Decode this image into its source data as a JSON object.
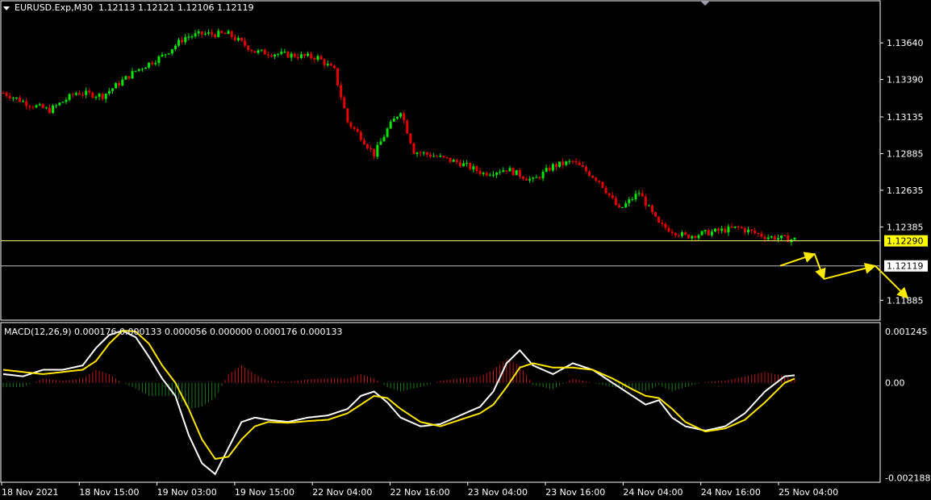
{
  "window": {
    "symbol_header": "EURUSD.Exp,M30",
    "ohlc": [
      "1.12113",
      "1.12121",
      "1.12106",
      "1.12119"
    ]
  },
  "colors": {
    "background": "#000000",
    "frame": "#ffffff",
    "bull": "#00e600",
    "bear": "#e60000",
    "level_line": "#ffff66",
    "price_line": "#c0c0c0",
    "arrow": "#ffeb00",
    "macd_main": "#ffffff",
    "macd_signal": "#ffe600",
    "hist_pos": "#c01818",
    "hist_neg": "#187818"
  },
  "chart_data": [
    {
      "type": "candlestick",
      "title": "EURUSD.Exp,M30",
      "ylim": [
        1.1176,
        1.1385
      ],
      "y_ticks": [
        "1.13640",
        "1.13390",
        "1.13135",
        "1.12885",
        "1.12635",
        "1.12385",
        "1.11885"
      ],
      "y_tick_values": [
        1.1364,
        1.1339,
        1.13135,
        1.12885,
        1.12635,
        1.12385,
        1.11885
      ],
      "x_ticks": [
        "18 Nov 2021",
        "18 Nov 15:00",
        "19 Nov 03:00",
        "19 Nov 15:00",
        "22 Nov 04:00",
        "22 Nov 16:00",
        "23 Nov 04:00",
        "23 Nov 16:00",
        "24 Nov 04:00",
        "24 Nov 16:00",
        "25 Nov 04:00"
      ],
      "bar_count": 240,
      "close_path": [
        [
          0,
          1.133
        ],
        [
          8,
          1.1322
        ],
        [
          14,
          1.1318
        ],
        [
          22,
          1.133
        ],
        [
          30,
          1.1328
        ],
        [
          40,
          1.1345
        ],
        [
          48,
          1.1355
        ],
        [
          55,
          1.1368
        ],
        [
          60,
          1.137
        ],
        [
          68,
          1.137
        ],
        [
          76,
          1.1358
        ],
        [
          85,
          1.1356
        ],
        [
          95,
          1.1354
        ],
        [
          100,
          1.1345
        ],
        [
          104,
          1.131
        ],
        [
          108,
          1.13
        ],
        [
          112,
          1.1288
        ],
        [
          116,
          1.1305
        ],
        [
          120,
          1.1318
        ],
        [
          124,
          1.129
        ],
        [
          130,
          1.1287
        ],
        [
          138,
          1.1282
        ],
        [
          145,
          1.1275
        ],
        [
          152,
          1.1278
        ],
        [
          160,
          1.127
        ],
        [
          166,
          1.128
        ],
        [
          172,
          1.1283
        ],
        [
          180,
          1.127
        ],
        [
          186,
          1.125
        ],
        [
          192,
          1.1262
        ],
        [
          198,
          1.124
        ],
        [
          206,
          1.1232
        ],
        [
          214,
          1.1235
        ],
        [
          222,
          1.1238
        ],
        [
          230,
          1.1232
        ],
        [
          238,
          1.123
        ]
      ],
      "levels": [
        {
          "label": "1.12290",
          "value": 1.1229,
          "style": "highlight"
        },
        {
          "label": "1.12119",
          "value": 1.12119,
          "style": "current"
        }
      ],
      "annotations": [
        {
          "type": "arrow",
          "from": [
            1.1212,
            0.838
          ],
          "to": [
            1.122,
            0.875
          ]
        },
        {
          "type": "arrow",
          "from": [
            1.122,
            0.875
          ],
          "to": [
            1.1203,
            0.885
          ]
        },
        {
          "type": "arrow",
          "from": [
            1.1203,
            0.885
          ],
          "to": [
            1.1212,
            0.94
          ]
        },
        {
          "type": "arrow",
          "from": [
            1.1212,
            0.94
          ],
          "to": [
            1.119,
            0.975
          ]
        }
      ]
    },
    {
      "type": "macd",
      "title": "MACD(12,26,9) 0.000176 0.000133 0.000056 0.000000 0.000176 0.000133",
      "ylim": [
        -0.00225,
        0.00133
      ],
      "y_ticks": [
        "0.001245",
        "0.00",
        "-0.002188"
      ],
      "y_tick_values": [
        0.001245,
        0.0,
        -0.002188
      ],
      "series": [
        {
          "role": "main",
          "points": [
            [
              0,
              0.0002
            ],
            [
              6,
              0.00015
            ],
            [
              12,
              0.0003
            ],
            [
              18,
              0.0003
            ],
            [
              24,
              0.0004
            ],
            [
              28,
              0.0008
            ],
            [
              32,
              0.0011
            ],
            [
              36,
              0.0012
            ],
            [
              40,
              0.00105
            ],
            [
              44,
              0.0006
            ],
            [
              48,
              0.0001
            ],
            [
              52,
              -0.0003
            ],
            [
              56,
              -0.0012
            ],
            [
              60,
              -0.00185
            ],
            [
              64,
              -0.0021
            ],
            [
              68,
              -0.0015
            ],
            [
              72,
              -0.0009
            ],
            [
              76,
              -0.0008
            ],
            [
              80,
              -0.00085
            ],
            [
              86,
              -0.0009
            ],
            [
              92,
              -0.0008
            ],
            [
              98,
              -0.00075
            ],
            [
              104,
              -0.0006
            ],
            [
              108,
              -0.0003
            ],
            [
              112,
              -0.0002
            ],
            [
              116,
              -0.00045
            ],
            [
              120,
              -0.0008
            ],
            [
              126,
              -0.001
            ],
            [
              132,
              -0.00095
            ],
            [
              138,
              -0.00075
            ],
            [
              144,
              -0.00055
            ],
            [
              148,
              -0.0002
            ],
            [
              152,
              0.00045
            ],
            [
              156,
              0.00075
            ],
            [
              160,
              0.0004
            ],
            [
              166,
              0.0002
            ],
            [
              172,
              0.00045
            ],
            [
              178,
              0.0003
            ],
            [
              184,
              0.0
            ],
            [
              190,
              -0.0003
            ],
            [
              194,
              -0.0005
            ],
            [
              198,
              -0.0004
            ],
            [
              202,
              -0.0008
            ],
            [
              206,
              -0.001
            ],
            [
              212,
              -0.0011
            ],
            [
              218,
              -0.001
            ],
            [
              224,
              -0.0007
            ],
            [
              230,
              -0.0002
            ],
            [
              236,
              0.00015
            ],
            [
              240,
              0.00018
            ]
          ]
        },
        {
          "role": "signal",
          "points": [
            [
              0,
              0.0003
            ],
            [
              6,
              0.00025
            ],
            [
              12,
              0.0002
            ],
            [
              18,
              0.00025
            ],
            [
              24,
              0.0003
            ],
            [
              28,
              0.0005
            ],
            [
              32,
              0.0009
            ],
            [
              36,
              0.0012
            ],
            [
              40,
              0.00118
            ],
            [
              44,
              0.0009
            ],
            [
              48,
              0.0004
            ],
            [
              52,
              0.0
            ],
            [
              56,
              -0.0006
            ],
            [
              60,
              -0.0013
            ],
            [
              64,
              -0.00175
            ],
            [
              68,
              -0.0017
            ],
            [
              72,
              -0.0013
            ],
            [
              76,
              -0.001
            ],
            [
              80,
              -0.0009
            ],
            [
              86,
              -0.00092
            ],
            [
              92,
              -0.00088
            ],
            [
              98,
              -0.00085
            ],
            [
              104,
              -0.0007
            ],
            [
              108,
              -0.0005
            ],
            [
              112,
              -0.0003
            ],
            [
              116,
              -0.00035
            ],
            [
              120,
              -0.0006
            ],
            [
              126,
              -0.0009
            ],
            [
              132,
              -0.001
            ],
            [
              138,
              -0.00085
            ],
            [
              144,
              -0.0007
            ],
            [
              148,
              -0.0005
            ],
            [
              152,
              -0.0001
            ],
            [
              156,
              0.00035
            ],
            [
              160,
              0.00045
            ],
            [
              166,
              0.00035
            ],
            [
              172,
              0.00035
            ],
            [
              178,
              0.0003
            ],
            [
              184,
              0.0001
            ],
            [
              190,
              -0.00015
            ],
            [
              194,
              -0.0003
            ],
            [
              198,
              -0.00035
            ],
            [
              202,
              -0.0006
            ],
            [
              206,
              -0.0009
            ],
            [
              212,
              -0.00112
            ],
            [
              218,
              -0.00105
            ],
            [
              224,
              -0.00085
            ],
            [
              230,
              -0.00045
            ],
            [
              236,
              0.0
            ],
            [
              240,
              0.00013
            ]
          ]
        }
      ]
    }
  ]
}
